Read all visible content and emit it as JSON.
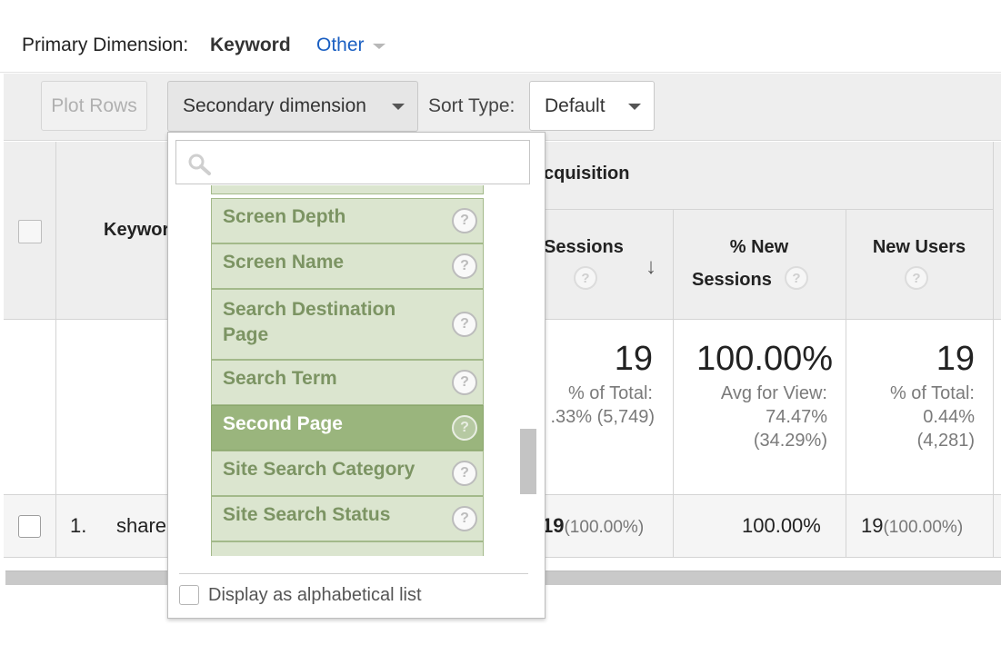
{
  "primary_dimension": {
    "label": "Primary Dimension:",
    "value": "Keyword",
    "other_label": "Other"
  },
  "toolbar": {
    "plot_rows_label": "Plot Rows",
    "secondary_dimension_label": "Secondary dimension",
    "sort_type_label": "Sort Type:",
    "sort_type_value": "Default"
  },
  "table": {
    "keyword_header": "Keywor",
    "group_header": "cquisition",
    "columns": [
      {
        "label": "Sessions"
      },
      {
        "label_line1": "% New",
        "label_line2": "Sessions"
      },
      {
        "label": "New Users"
      }
    ],
    "totals": {
      "sessions_value": "19",
      "sessions_sub1": "% of Total:",
      "sessions_sub2": ".33% (5,749)",
      "new_sessions_value": "100.00%",
      "new_sessions_sub1": "Avg for View:",
      "new_sessions_sub2": "74.47%",
      "new_sessions_sub3": "(34.29%)",
      "new_users_value": "19",
      "new_users_sub1": "% of Total:",
      "new_users_sub2": "0.44%",
      "new_users_sub3": "(4,281)"
    },
    "rows": [
      {
        "index": "1.",
        "keyword": "share",
        "sessions": "19",
        "sessions_pct": "(100.00%)",
        "new_sessions": "100.00%",
        "new_users": "19",
        "new_users_pct": "(100.00%)"
      }
    ]
  },
  "dropdown": {
    "search_placeholder": "",
    "items": [
      {
        "label": "Screen Depth",
        "selected": false
      },
      {
        "label": "Screen Name",
        "selected": false
      },
      {
        "label": "Search Destination Page",
        "selected": false
      },
      {
        "label": "Search Term",
        "selected": false
      },
      {
        "label": "Second Page",
        "selected": true
      },
      {
        "label": "Site Search Category",
        "selected": false
      },
      {
        "label": "Site Search Status",
        "selected": false
      }
    ],
    "help_glyph": "?",
    "alphabetical_label": "Display as alphabetical list"
  },
  "sort_arrow_glyph": "↓",
  "colors": {
    "item_bg": "#dbe5cf",
    "item_selected_bg": "#9ab57d",
    "item_text": "#7c9463",
    "link_blue": "#1a5fc2"
  }
}
